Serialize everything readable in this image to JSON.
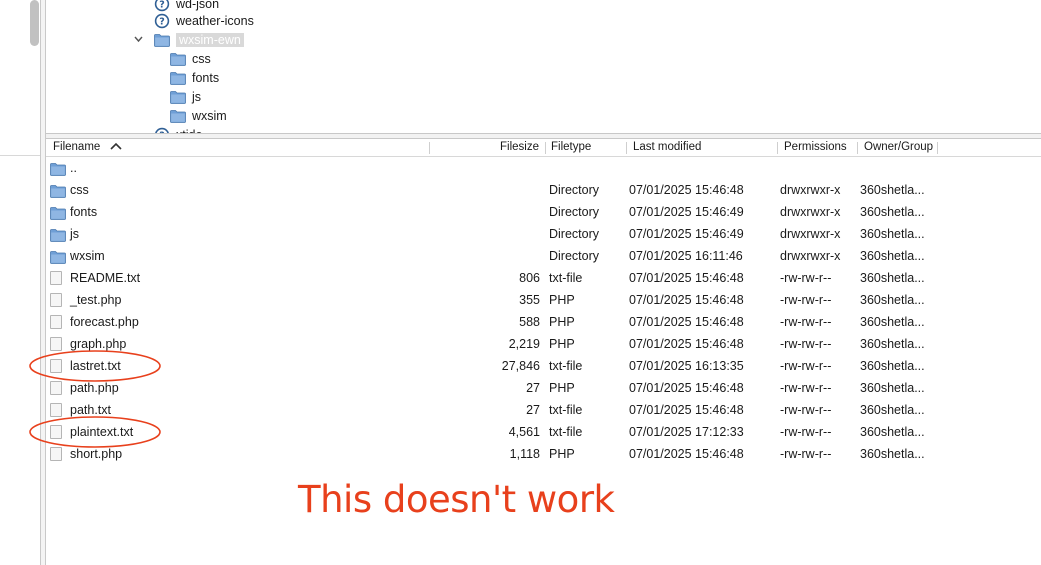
{
  "tree": {
    "items": [
      {
        "label": "wd-json",
        "icon": "help-icon"
      },
      {
        "label": "weather-icons",
        "icon": "help-icon"
      },
      {
        "label": "wxsim-ewn",
        "icon": "folder-icon",
        "expanded": true,
        "selected": true
      },
      {
        "label": "css",
        "icon": "folder-icon"
      },
      {
        "label": "fonts",
        "icon": "folder-icon"
      },
      {
        "label": "js",
        "icon": "folder-icon"
      },
      {
        "label": "wxsim",
        "icon": "folder-icon"
      },
      {
        "label": "xtide",
        "icon": "help-icon"
      }
    ]
  },
  "list": {
    "columns": {
      "filename": "Filename",
      "filesize": "Filesize",
      "filetype": "Filetype",
      "modified": "Last modified",
      "permissions": "Permissions",
      "owner": "Owner/Group"
    },
    "sort_icon": "chevron-up-icon",
    "rows": [
      {
        "name": "..",
        "size": "",
        "type": "",
        "modified": "",
        "perm": "",
        "owner": "",
        "icon": "folder-icon"
      },
      {
        "name": "css",
        "size": "",
        "type": "Directory",
        "modified": "07/01/2025 15:46:48",
        "perm": "drwxrwxr-x",
        "owner": "360shetla...",
        "icon": "folder-icon"
      },
      {
        "name": "fonts",
        "size": "",
        "type": "Directory",
        "modified": "07/01/2025 15:46:49",
        "perm": "drwxrwxr-x",
        "owner": "360shetla...",
        "icon": "folder-icon"
      },
      {
        "name": "js",
        "size": "",
        "type": "Directory",
        "modified": "07/01/2025 15:46:49",
        "perm": "drwxrwxr-x",
        "owner": "360shetla...",
        "icon": "folder-icon"
      },
      {
        "name": "wxsim",
        "size": "",
        "type": "Directory",
        "modified": "07/01/2025 16:11:46",
        "perm": "drwxrwxr-x",
        "owner": "360shetla...",
        "icon": "folder-icon"
      },
      {
        "name": "README.txt",
        "size": "806",
        "type": "txt-file",
        "modified": "07/01/2025 15:46:48",
        "perm": "-rw-rw-r--",
        "owner": "360shetla...",
        "icon": "file-icon"
      },
      {
        "name": "_test.php",
        "size": "355",
        "type": "PHP",
        "modified": "07/01/2025 15:46:48",
        "perm": "-rw-rw-r--",
        "owner": "360shetla...",
        "icon": "file-icon"
      },
      {
        "name": "forecast.php",
        "size": "588",
        "type": "PHP",
        "modified": "07/01/2025 15:46:48",
        "perm": "-rw-rw-r--",
        "owner": "360shetla...",
        "icon": "file-icon"
      },
      {
        "name": "graph.php",
        "size": "2,219",
        "type": "PHP",
        "modified": "07/01/2025 15:46:48",
        "perm": "-rw-rw-r--",
        "owner": "360shetla...",
        "icon": "file-icon"
      },
      {
        "name": "lastret.txt",
        "size": "27,846",
        "type": "txt-file",
        "modified": "07/01/2025 16:13:35",
        "perm": "-rw-rw-r--",
        "owner": "360shetla...",
        "icon": "file-icon",
        "circled": true
      },
      {
        "name": "path.php",
        "size": "27",
        "type": "PHP",
        "modified": "07/01/2025 15:46:48",
        "perm": "-rw-rw-r--",
        "owner": "360shetla...",
        "icon": "file-icon"
      },
      {
        "name": "path.txt",
        "size": "27",
        "type": "txt-file",
        "modified": "07/01/2025 15:46:48",
        "perm": "-rw-rw-r--",
        "owner": "360shetla...",
        "icon": "file-icon"
      },
      {
        "name": "plaintext.txt",
        "size": "4,561",
        "type": "txt-file",
        "modified": "07/01/2025 17:12:33",
        "perm": "-rw-rw-r--",
        "owner": "360shetla...",
        "icon": "file-icon",
        "circled": true
      },
      {
        "name": "short.php",
        "size": "1,118",
        "type": "PHP",
        "modified": "07/01/2025 15:46:48",
        "perm": "-rw-rw-r--",
        "owner": "360shetla...",
        "icon": "file-icon"
      }
    ]
  },
  "annotation": {
    "text": "This doesn't work",
    "color": "#e8401c"
  },
  "colors": {
    "folder": "#6f9fd6",
    "help_icon": "#2f5f95",
    "annotation": "#e8401c"
  }
}
